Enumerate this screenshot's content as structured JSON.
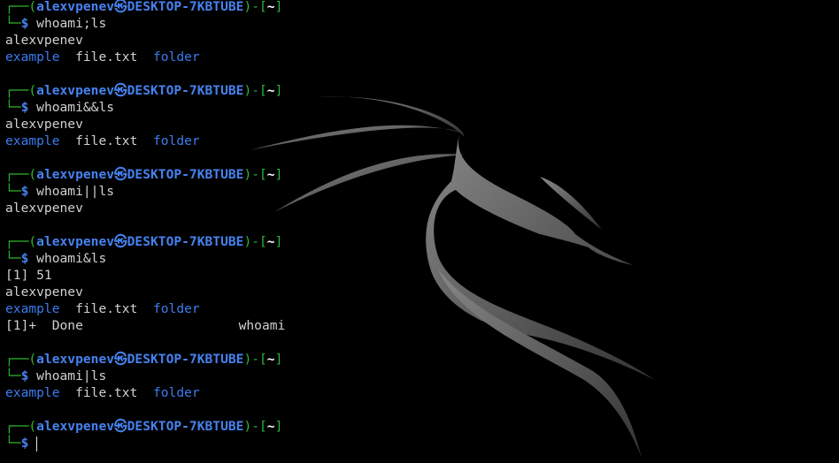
{
  "prompt": {
    "user": "alexvpenev",
    "host": "DESKTOP-7KBTUBE",
    "path": "~",
    "symbol": "$",
    "at_glyph": "㉿"
  },
  "colors": {
    "prompt_frame": "#2db82d",
    "prompt_user": "#4682f0",
    "directory": "#3b7cf0",
    "text": "#d0d0d0",
    "background": "#000000"
  },
  "blocks": [
    {
      "command": "whoami;ls",
      "output": [
        {
          "type": "text",
          "text": "alexvpenev"
        },
        {
          "type": "ls",
          "items": [
            {
              "name": "example",
              "dir": true
            },
            {
              "name": "file.txt",
              "dir": false
            },
            {
              "name": "folder",
              "dir": true
            }
          ]
        }
      ]
    },
    {
      "command": "whoami&&ls",
      "output": [
        {
          "type": "text",
          "text": "alexvpenev"
        },
        {
          "type": "ls",
          "items": [
            {
              "name": "example",
              "dir": true
            },
            {
              "name": "file.txt",
              "dir": false
            },
            {
              "name": "folder",
              "dir": true
            }
          ]
        }
      ]
    },
    {
      "command": "whoami||ls",
      "output": [
        {
          "type": "text",
          "text": "alexvpenev"
        }
      ]
    },
    {
      "command": "whoami&ls",
      "output": [
        {
          "type": "text",
          "text": "[1] 51"
        },
        {
          "type": "text",
          "text": "alexvpenev"
        },
        {
          "type": "ls",
          "items": [
            {
              "name": "example",
              "dir": true
            },
            {
              "name": "file.txt",
              "dir": false
            },
            {
              "name": "folder",
              "dir": true
            }
          ]
        },
        {
          "type": "text",
          "text": "[1]+  Done                    whoami"
        }
      ]
    },
    {
      "command": "whoami|ls",
      "output": [
        {
          "type": "ls",
          "items": [
            {
              "name": "example",
              "dir": true
            },
            {
              "name": "file.txt",
              "dir": false
            },
            {
              "name": "folder",
              "dir": true
            }
          ]
        }
      ]
    },
    {
      "command": "",
      "active": true,
      "output": []
    }
  ]
}
